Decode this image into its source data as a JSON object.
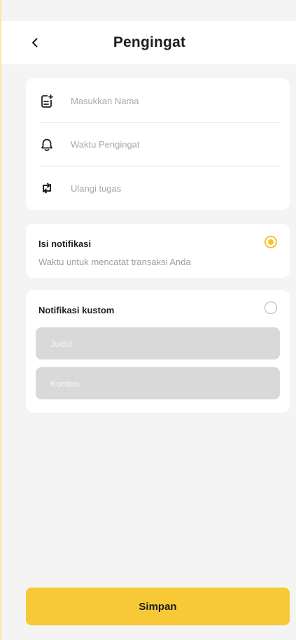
{
  "header": {
    "title": "Pengingat",
    "back_icon": "chevron-left-icon"
  },
  "form": {
    "name_placeholder": "Masukkan Nama",
    "name_icon": "note-add-icon",
    "time_placeholder": "Waktu Pengingat",
    "time_icon": "bell-icon",
    "repeat_placeholder": "Ulangi tugas",
    "repeat_icon": "repeat-icon"
  },
  "notification": {
    "title": "Isi notifikasi",
    "subtitle": "Waktu untuk mencatat transaksi Anda",
    "selected": true
  },
  "custom": {
    "title": "Notifikasi kustom",
    "selected": false,
    "title_placeholder": "Judul",
    "content_placeholder": "Konten"
  },
  "actions": {
    "save_label": "Simpan"
  },
  "colors": {
    "accent": "#f8c936",
    "radio_active": "#f7c430",
    "field_bg": "#d9d9d9"
  }
}
